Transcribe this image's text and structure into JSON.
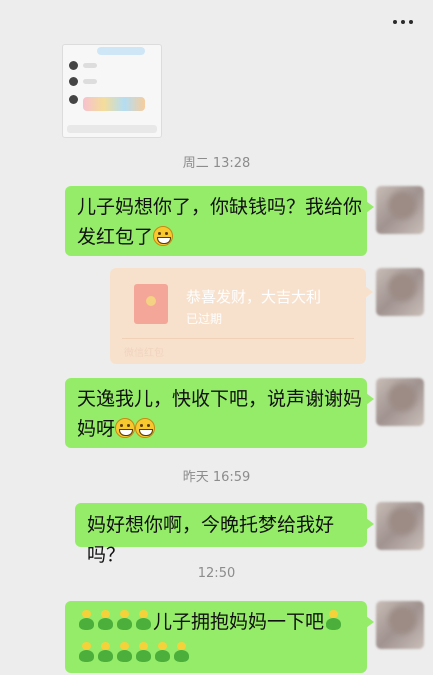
{
  "header": {
    "more_icon": "more-dots-icon"
  },
  "messages": {
    "t1": "周二 13:28",
    "m1": "儿子妈想你了，你缺钱吗？我给你",
    "m1b": "发红包了",
    "redpacket": {
      "title": "恭喜发财，大吉大利",
      "status": "已过期",
      "footer": "微信红包"
    },
    "m2": "天逸我儿，快收下吧，说声谢谢妈",
    "m2b": "妈呀",
    "t2": "昨天 16:59",
    "m3": "妈好想你啊，今晚托梦给我好吗？",
    "t3": "12:50",
    "m4": "儿子拥抱妈妈一下吧"
  },
  "colors": {
    "bubble": "#95ec69",
    "background": "#ededed",
    "redpacket": "#f9e1cb"
  }
}
